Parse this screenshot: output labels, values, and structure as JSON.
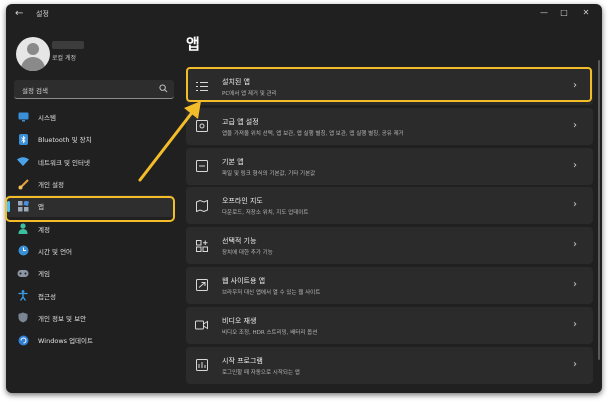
{
  "app": {
    "title": "설정"
  },
  "window_controls": {
    "minimize": "—",
    "maximize": "□",
    "close": "✕"
  },
  "user": {
    "subtitle": "로컬 계정"
  },
  "search": {
    "value": "설정 검색"
  },
  "sidebar": {
    "items": [
      {
        "label": "시스템",
        "icon": "monitor-icon"
      },
      {
        "label": "Bluetooth 및 장치",
        "icon": "bluetooth-icon"
      },
      {
        "label": "네트워크 및 인터넷",
        "icon": "wifi-icon"
      },
      {
        "label": "개인 설정",
        "icon": "brush-icon"
      },
      {
        "label": "앱",
        "icon": "apps-icon",
        "selected": true
      },
      {
        "label": "계정",
        "icon": "person-icon"
      },
      {
        "label": "시간 및 언어",
        "icon": "globe-clock-icon"
      },
      {
        "label": "게임",
        "icon": "game-icon"
      },
      {
        "label": "접근성",
        "icon": "accessibility-icon"
      },
      {
        "label": "개인 정보 및 보안",
        "icon": "shield-icon"
      },
      {
        "label": "Windows 업데이트",
        "icon": "update-icon"
      }
    ]
  },
  "main": {
    "title": "앱",
    "cards": [
      {
        "title": "설치된 앱",
        "desc": "PC에서 앱 제거 및 관리",
        "icon": "list-icon"
      },
      {
        "title": "고급 앱 설정",
        "desc": "앱을 가져올 위치 선택, 앱 보관, 앱 실행 별칭, 앱 보관, 앱 실행 별칭, 공유 제거",
        "icon": "advanced-apps-icon"
      },
      {
        "title": "기본 앱",
        "desc": "파일 및 링크 형식의 기본값, 기타 기본값",
        "icon": "default-apps-icon"
      },
      {
        "title": "오프라인 지도",
        "desc": "다운로드, 저장소 위치, 지도 업데이트",
        "icon": "map-icon"
      },
      {
        "title": "선택적 기능",
        "desc": "장치에 대한 추가 기능",
        "icon": "optional-features-icon"
      },
      {
        "title": "웹 사이트용 앱",
        "desc": "브라우저 대신 앱에서 열 수 있는 웹 사이트",
        "icon": "web-apps-icon"
      },
      {
        "title": "비디오 재생",
        "desc": "비디오 조정, HDR 스트리밍, 배터리 옵션",
        "icon": "video-icon"
      },
      {
        "title": "시작 프로그램",
        "desc": "로그인할 때 자동으로 시작되는 앱",
        "icon": "startup-icon"
      }
    ]
  },
  "colors": {
    "accent": "#4cc2ff",
    "highlight": "#f3bd2a",
    "window_bg": "#202020",
    "card_bg": "#2b2b2b"
  }
}
